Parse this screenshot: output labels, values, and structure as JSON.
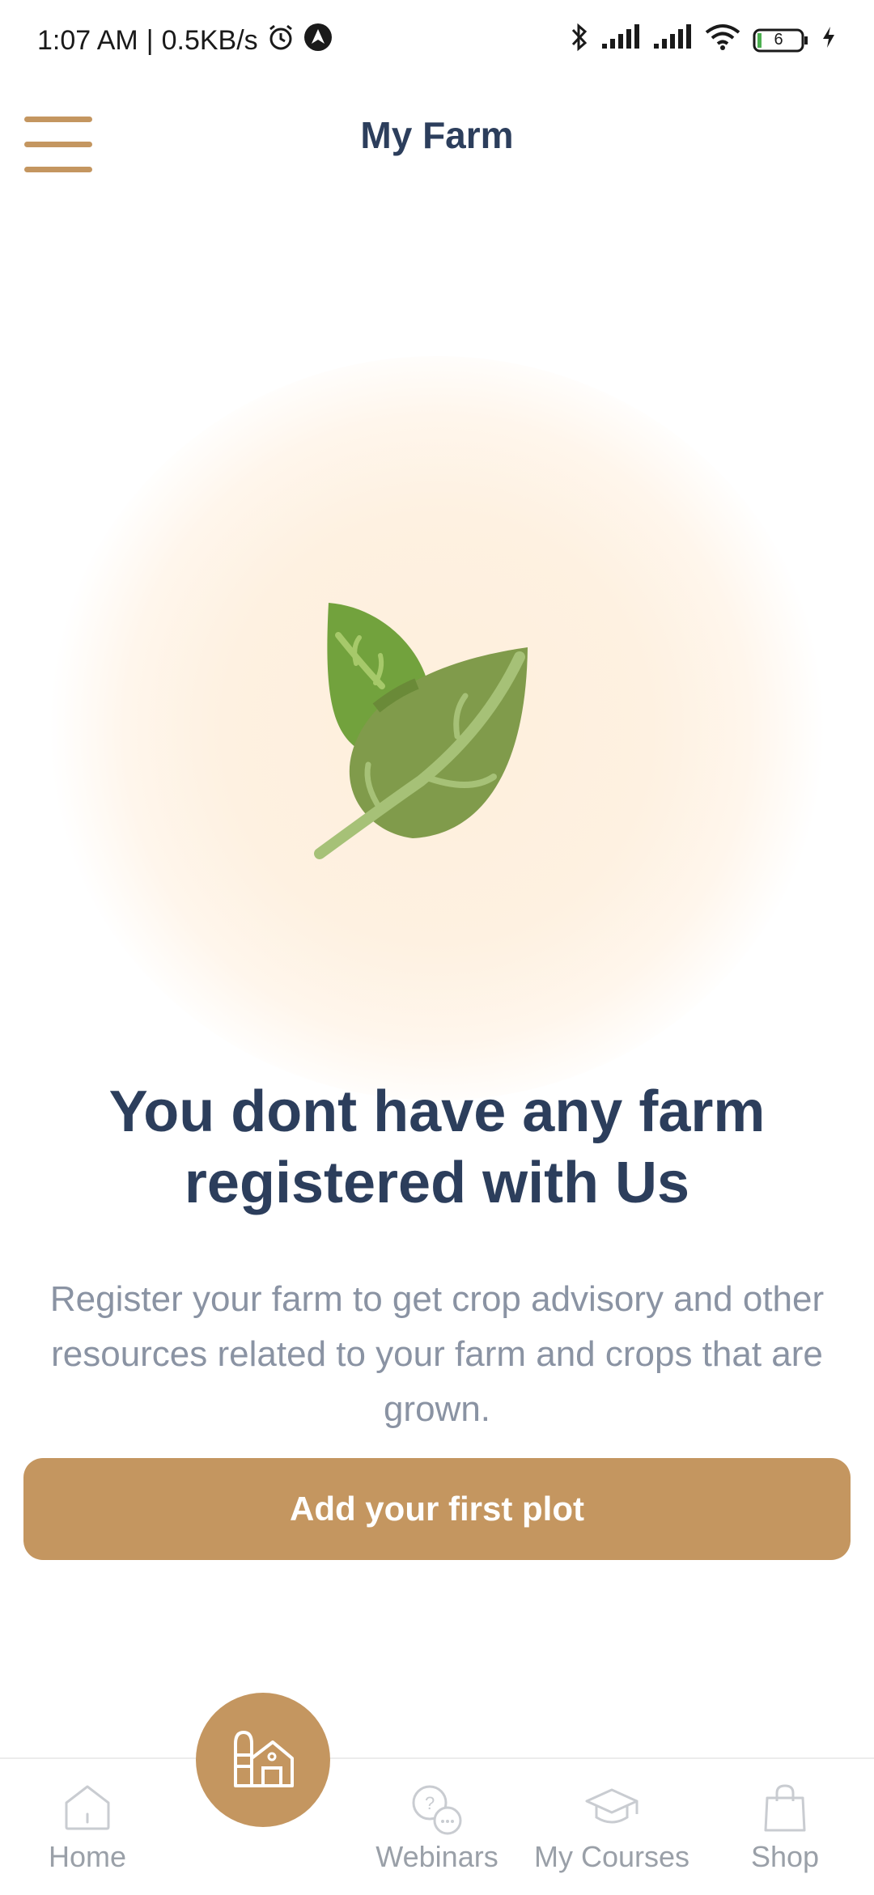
{
  "status": {
    "time": "1:07 AM",
    "net_speed": "0.5KB/s",
    "battery": "6"
  },
  "header": {
    "title": "My Farm"
  },
  "empty_state": {
    "headline": "You dont have any farm registered with Us",
    "description": "Register your farm to get crop advisory and other resources related to your farm and crops that are grown.",
    "cta_label": "Add your first plot"
  },
  "nav": {
    "items": [
      {
        "label": "Home",
        "icon": "home-icon"
      },
      {
        "label": "Webinars",
        "icon": "chat-help-icon"
      },
      {
        "label": "My Courses",
        "icon": "graduation-cap-icon"
      },
      {
        "label": "Shop",
        "icon": "shopping-bag-icon"
      }
    ],
    "fab_icon": "farm-barn-icon"
  },
  "colors": {
    "accent": "#c49660",
    "text_primary": "#2c3e5c",
    "text_muted": "#8a93a3"
  }
}
